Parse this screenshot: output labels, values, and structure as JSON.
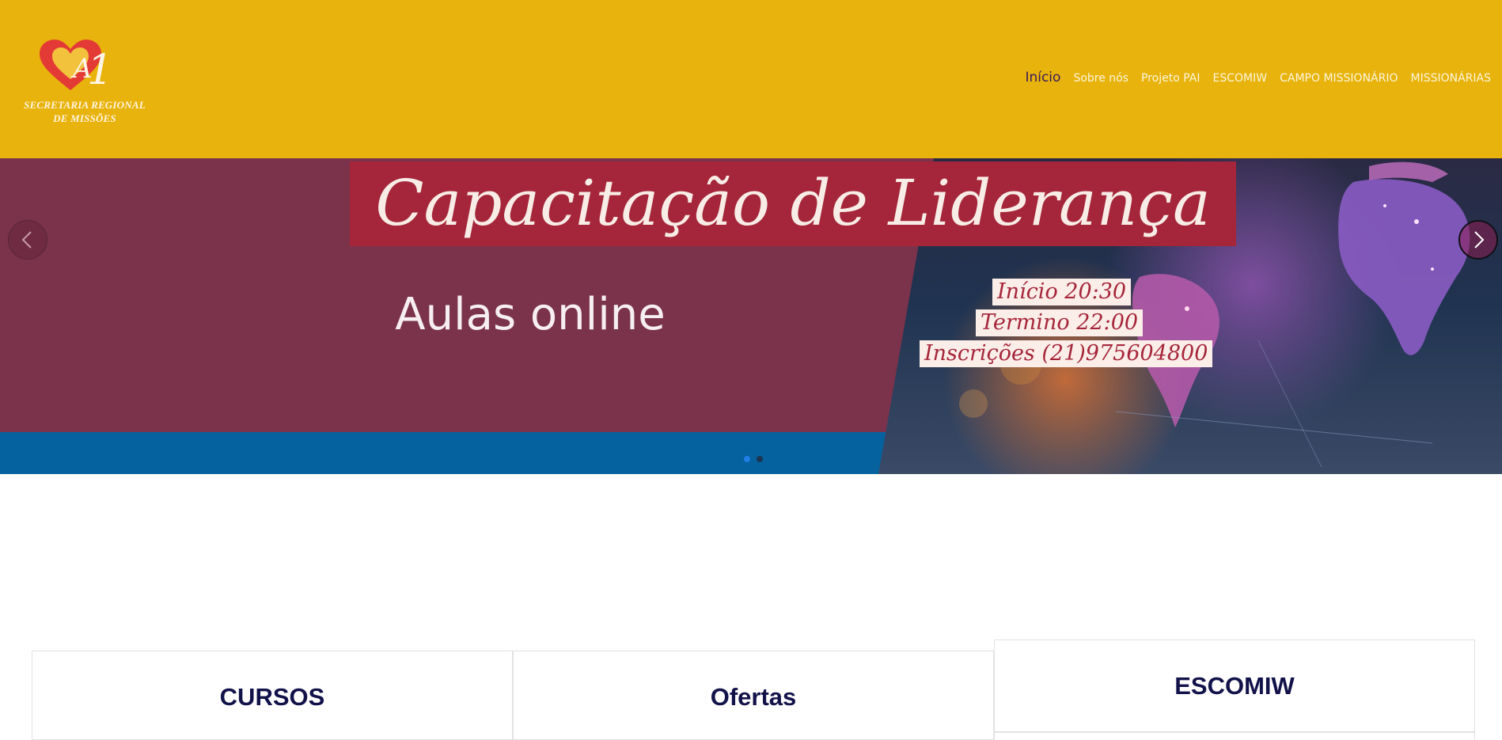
{
  "header": {
    "logo_text_line1": "SECRETARIA REGIONAL",
    "logo_text_line2": "DE MISSÕES",
    "nav": [
      {
        "label": "Início",
        "active": true
      },
      {
        "label": "Sobre nós"
      },
      {
        "label": "Projeto PAI"
      },
      {
        "label": "ESCOMIW"
      },
      {
        "label": "CAMPO MISSIONÁRIO"
      },
      {
        "label": "MISSIONÁRIAS"
      }
    ]
  },
  "slider": {
    "headline": "Capacitação de Liderança",
    "subtitle": "Aulas online",
    "info": [
      "Início 20:30",
      "Termino 22:00",
      "Inscrições (21)975604800"
    ],
    "slide_count": 2,
    "active_slide": 1
  },
  "cards": [
    {
      "title": "CURSOS"
    },
    {
      "title": "Ofertas"
    },
    {
      "title": "ESCOMIW"
    }
  ],
  "colors": {
    "header_bg": "#e8b30c",
    "slide_bg": "#7a334b",
    "headline_box": "#a5263a",
    "slide_stripe": "#05629f",
    "card_title": "#12124a",
    "nav_active": "#3a1a5c"
  }
}
